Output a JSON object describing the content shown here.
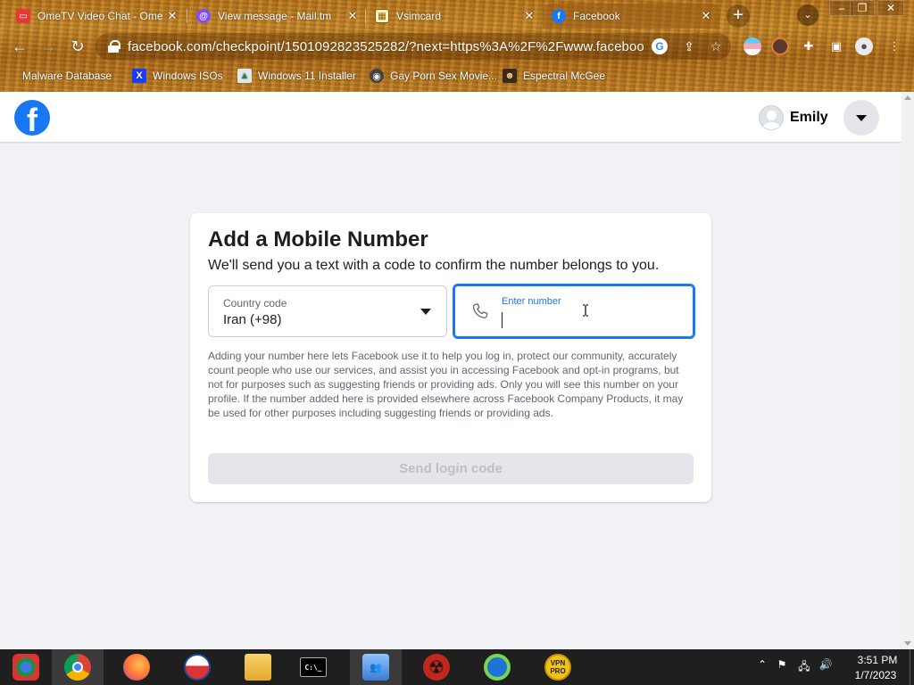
{
  "browser": {
    "tabs": [
      {
        "title": "OmeTV Video Chat - Ome",
        "icon": "ometv-icon",
        "active": false
      },
      {
        "title": "View message - Mail.tm",
        "icon": "mailtm-icon",
        "active": false
      },
      {
        "title": "Vsimcard",
        "icon": "vsimcard-icon",
        "active": false
      },
      {
        "title": "Facebook",
        "icon": "facebook-icon",
        "active": true
      }
    ],
    "new_tab": "+",
    "address_url": "facebook.com/checkpoint/1501092823525282/?next=https%3A%2F%2Fwww.faceboo...",
    "bookmarks": [
      {
        "label": "Malware Database",
        "icon": "malware-icon"
      },
      {
        "label": "Windows ISOs",
        "icon": "x-icon"
      },
      {
        "label": "Windows 11 Installer",
        "icon": "picture-icon"
      },
      {
        "label": "Gay Porn Sex Movie...",
        "icon": "bookmark-globe-icon"
      },
      {
        "label": "Espectral McGee",
        "icon": "character-icon"
      }
    ]
  },
  "facebook": {
    "profile_name": "Emily",
    "card": {
      "title": "Add a Mobile Number",
      "subtitle": "We'll send you a text with a code to confirm the number belongs to you.",
      "country_label": "Country code",
      "country_value": "Iran (+98)",
      "number_label": "Enter number",
      "number_value": "",
      "disclaimer": "Adding your number here lets Facebook use it to help you log in, protect our community, accurately count people who use our services, and assist you in accessing Facebook and opt-in programs, but not for purposes such as suggesting friends or providing ads. Only you will see this number on your profile. If the number added here is provided elsewhere across Facebook Company Products, it may be used for other purposes including suggesting friends or providing ads.",
      "send_button": "Send login code"
    },
    "colors": {
      "brand": "#1877f2",
      "focus": "#1877f2",
      "disabled_button": "#e4e6eb",
      "disabled_text": "#bcc0c4"
    }
  },
  "taskbar": {
    "apps": [
      "windows-start-icon",
      "chrome-icon",
      "firefox-icon",
      "obama-icon",
      "file-explorer-icon",
      "cmd-icon",
      "users-icon",
      "radiation-icon",
      "opera-gx-icon",
      "vpn-pro-icon"
    ],
    "vpn_label": "VPN PRO",
    "cmd_label": "C:\\_",
    "time": "3:51 PM",
    "date": "1/7/2023"
  }
}
